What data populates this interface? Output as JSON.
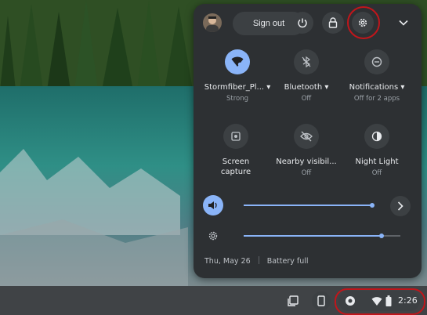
{
  "header": {
    "sign_out_label": "Sign out"
  },
  "tiles": [
    {
      "label": "Stormfiber_Pl...",
      "sub": "Strong",
      "icon": "wifi-icon",
      "on": true
    },
    {
      "label": "Bluetooth",
      "sub": "Off",
      "icon": "bluetooth-off-icon",
      "on": false
    },
    {
      "label": "Notifications",
      "sub": "Off for 2 apps",
      "icon": "notifications-off-icon",
      "on": false
    },
    {
      "label": "Screen capture",
      "sub": "",
      "icon": "screen-capture-icon",
      "on": false
    },
    {
      "label": "Nearby visibil...",
      "sub": "Off",
      "icon": "nearby-visibility-off-icon",
      "on": false
    },
    {
      "label": "Night Light",
      "sub": "Off",
      "icon": "night-light-icon",
      "on": false
    }
  ],
  "sliders": {
    "volume_level": 0.82,
    "brightness_level": 0.88
  },
  "footer": {
    "date": "Thu, May 26",
    "battery": "Battery full"
  },
  "tray": {
    "time": "2:26"
  },
  "colors": {
    "panel_bg": "#2d3033",
    "accent": "#8ab4f8",
    "annotation_red": "#c0161b"
  }
}
